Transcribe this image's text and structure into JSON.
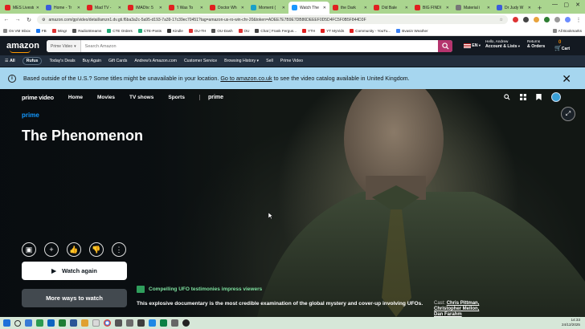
{
  "browser": {
    "tabs": [
      {
        "label": "MES Livestr",
        "color": "#e02020"
      },
      {
        "label": "Home - Tr",
        "color": "#3b5bdb"
      },
      {
        "label": "Mad TV -",
        "color": "#e02020"
      },
      {
        "label": "IMADtv: 5",
        "color": "#e02020"
      },
      {
        "label": "'I Was To",
        "color": "#e02020"
      },
      {
        "label": "Doctor Wh",
        "color": "#e02020"
      },
      {
        "label": "Moment (",
        "color": "#1aa0c8"
      },
      {
        "label": "Watch The",
        "color": "#1a98ff",
        "active": true
      },
      {
        "label": "the Dark",
        "color": "#e02020"
      },
      {
        "label": "Did Bale",
        "color": "#e02020"
      },
      {
        "label": "BIG FINDI",
        "color": "#e02020"
      },
      {
        "label": "Material i",
        "color": "#777777"
      },
      {
        "label": "Dr Judy W",
        "color": "#3b5bdb"
      }
    ],
    "new_tab": "+",
    "url": "amazon.com/gp/video/detail/amzn1.dv.gti.f6ba3a2c-5a95-d193-7a39-17c39ec70451?tag=amazon-us-ro-win-chr-20&token=ADEE7E7B9E7DB86DEEEF0D5D4FC5F0B5F844D3F",
    "bookmarks": [
      "On VM Inbox",
      "FB",
      "Mingr",
      "RadioStreams",
      "CTE Orders",
      "CTE-Posts",
      "Kindle",
      "OU-TH",
      "OU-Dash",
      "OU",
      "Chat | Frank Fergus...",
      "YTH",
      "YT MyVids",
      "Community - YouTu...",
      "Bvasin Weather"
    ],
    "all_bookmarks": "All Bookmarks"
  },
  "amazon": {
    "logo": "amazon",
    "search_dept": "Prime Video",
    "search_placeholder": "Search Amazon",
    "lang": "EN",
    "account_greeting": "Hello, Andrew",
    "account_label": "Account & Lists",
    "returns_label": "Returns",
    "orders_label": "& Orders",
    "cart_count": "0",
    "cart_label": "Cart",
    "subnav": [
      "All",
      "Rufus",
      "Today's Deals",
      "Buy Again",
      "Gift Cards",
      "Andrew's Amazon.com",
      "Customer Service",
      "Browsing History",
      "Sell",
      "Prime Video"
    ]
  },
  "banner": {
    "text_before": "Based outside of the U.S.? Some titles might be unavailable in your location.",
    "link": "Go to amazon.co.uk",
    "text_after": "to see the video catalog available in United Kingdom."
  },
  "prime_video": {
    "logo": "prime video",
    "nav": [
      "Home",
      "Movies",
      "TV shows",
      "Sports"
    ],
    "prime_label": "prime",
    "badge": "prime",
    "title": "The Phenomenon",
    "watch_label": "Watch again",
    "more_label": "More ways to watch",
    "tagline": "Compelling UFO testimonies impress viewers",
    "description": "This explosive documentary is the most credible examination of the global mystery and cover-up involving UFOs.",
    "cast_label": "Cast:",
    "cast": [
      "Chris Pittman,",
      "Christopher Mellon,",
      "Dan Farahm"
    ]
  },
  "taskbar": {
    "time": "14:33",
    "date": "24/12/2025"
  }
}
